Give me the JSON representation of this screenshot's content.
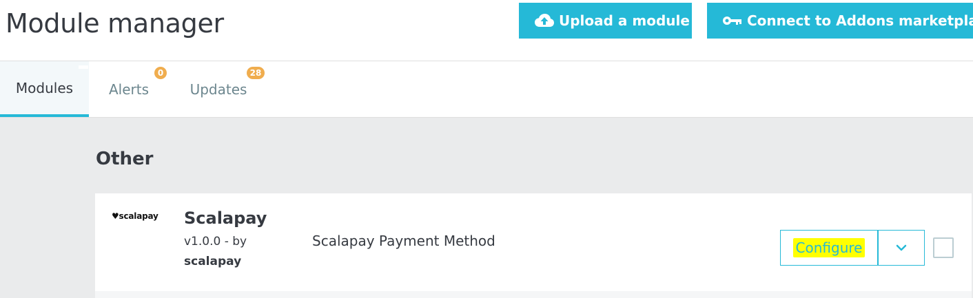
{
  "header": {
    "title": "Module manager",
    "upload_label": "Upload a module",
    "upload_icon": "cloud-upload-icon",
    "connect_label": "Connect to Addons marketplace",
    "connect_icon": "key-icon",
    "accent_color": "#25b9d7"
  },
  "tabs": [
    {
      "label": "Modules",
      "active": true
    },
    {
      "label": "Alerts",
      "badge": "0"
    },
    {
      "label": "Updates",
      "badge": "28"
    }
  ],
  "section": {
    "title": "Other"
  },
  "module": {
    "logo_text": "♥scalapay",
    "name": "Scalapay",
    "version": "v1.0.0 - by",
    "author": "scalapay",
    "description": "Scalapay Payment Method",
    "configure_label": "Configure",
    "dropdown_icon": "chevron-down-icon"
  }
}
